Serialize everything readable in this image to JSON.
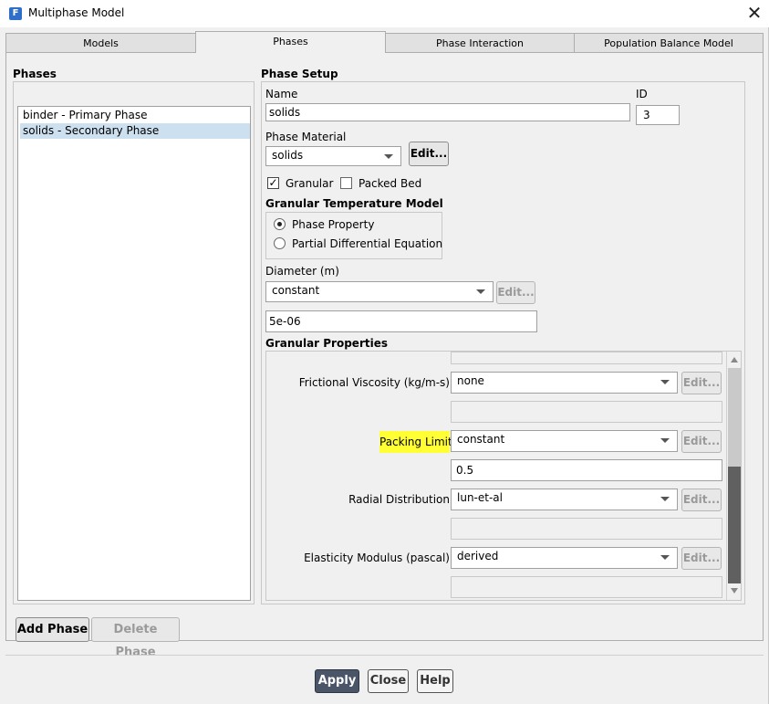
{
  "window": {
    "title": "Multiphase Model",
    "app_icon_glyph": "F",
    "close_glyph": "✕"
  },
  "tabs": [
    {
      "label": "Models",
      "active": false
    },
    {
      "label": "Phases",
      "active": true
    },
    {
      "label": "Phase Interaction",
      "active": false
    },
    {
      "label": "Population Balance Model",
      "active": false
    }
  ],
  "phases": {
    "heading": "Phases",
    "items": [
      {
        "label": "binder - Primary Phase",
        "selected": false
      },
      {
        "label": "solids - Secondary Phase",
        "selected": true
      }
    ],
    "add_button": "Add Phase",
    "delete_button": "Delete Phase"
  },
  "setup": {
    "heading": "Phase Setup",
    "name_label": "Name",
    "name_value": "solids",
    "id_label": "ID",
    "id_value": "3",
    "material_label": "Phase Material",
    "material_value": "solids",
    "material_edit": "Edit...",
    "granular_label": "Granular",
    "granular_checked": true,
    "packed_bed_label": "Packed Bed",
    "packed_bed_checked": false,
    "gtm_heading": "Granular Temperature Model",
    "gtm_options": [
      {
        "label": "Phase Property",
        "selected": true
      },
      {
        "label": "Partial Differential Equation",
        "selected": false
      }
    ],
    "diameter_label": "Diameter (m)",
    "diameter_method": "constant",
    "diameter_edit": "Edit...",
    "diameter_value": "5e-06",
    "granular_props_heading": "Granular Properties",
    "props": {
      "frictional_viscosity_label": "Frictional Viscosity (kg/m-s)",
      "frictional_viscosity_value": "none",
      "packing_limit_label": "Packing Limit",
      "packing_limit_method": "constant",
      "packing_limit_value": "0.5",
      "radial_distribution_label": "Radial Distribution",
      "radial_distribution_value": "lun-et-al",
      "elasticity_modulus_label": "Elasticity Modulus (pascal)",
      "elasticity_modulus_value": "derived",
      "edit_label": "Edit..."
    },
    "highlight_color": "#ffff33"
  },
  "footer": {
    "apply": "Apply",
    "close": "Close",
    "help": "Help"
  },
  "colors": {
    "apply_bg": "#4a5568",
    "selection": "#cde0ef"
  }
}
